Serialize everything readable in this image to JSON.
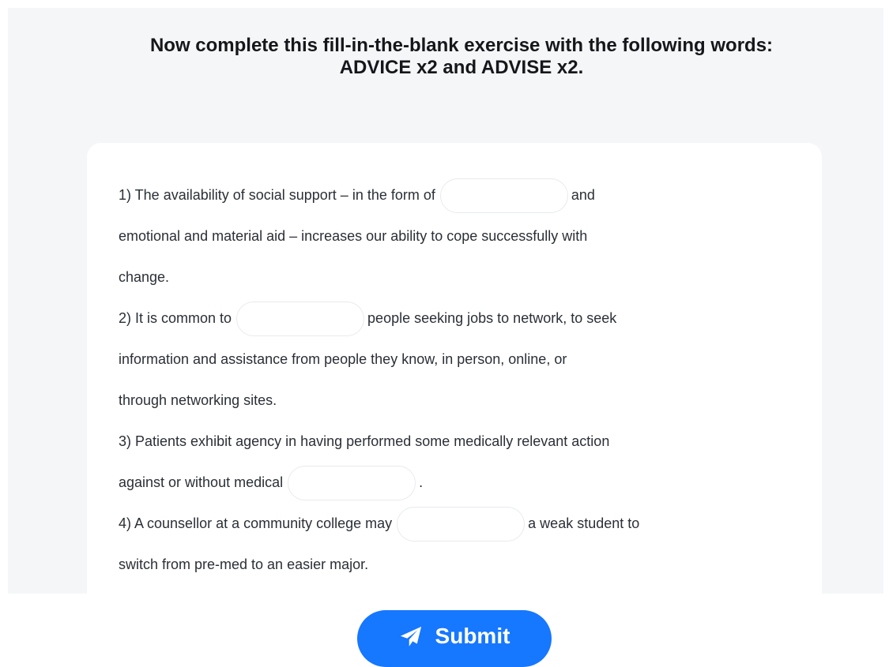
{
  "instruction": {
    "line1": "Now complete this fill-in-the-blank exercise with the following words:",
    "line2": "ADVICE x2 and ADVISE x2."
  },
  "exercise": {
    "q1": {
      "part1": "1) The availability of social support – in the form of",
      "part2": "and",
      "part3": "emotional and material aid – increases our ability to cope successfully with",
      "part4": "change.",
      "answer": ""
    },
    "q2": {
      "part1": "2) It is common to",
      "part2": "people seeking jobs to network, to seek",
      "part3": "information and assistance from people they know, in person, online, or",
      "part4": "through networking sites.",
      "answer": ""
    },
    "q3": {
      "part1": "3) Patients exhibit agency in having performed some medically relevant action",
      "part2": "against or without medical",
      "part3": ".",
      "answer": ""
    },
    "q4": {
      "part1": "4) A counsellor at a community college may",
      "part2": "a weak student to",
      "part3": "switch from pre-med to an easier major.",
      "answer": ""
    }
  },
  "submit": {
    "label": "Submit",
    "icon": "paper-plane-icon",
    "color": "#1677ff"
  },
  "colors": {
    "page_background": "#f5f6f8",
    "card_background": "#ffffff",
    "blank_border": "#e8eaee"
  }
}
